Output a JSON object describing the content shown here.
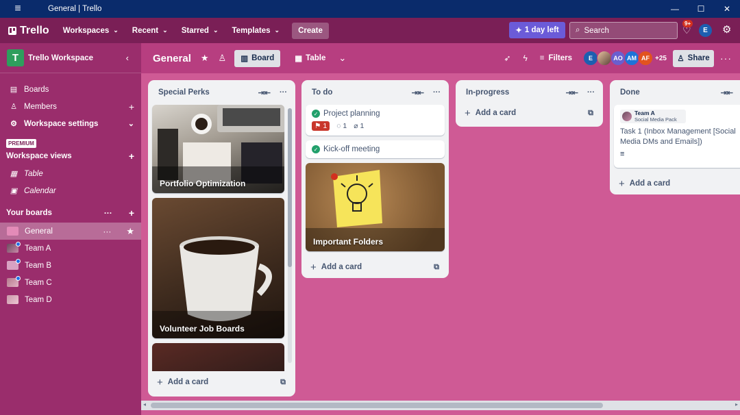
{
  "window": {
    "title": "General | Trello",
    "controls": [
      "—",
      "☐",
      "✕"
    ]
  },
  "topnav": {
    "logo": "Trello",
    "items": [
      "Workspaces",
      "Recent",
      "Starred",
      "Templates"
    ],
    "create": "Create",
    "trial": "1 day left",
    "search_placeholder": "Search",
    "notif_count": "9+",
    "avatar": "E"
  },
  "sidebar": {
    "workspace_initial": "T",
    "workspace_name": "Trello Workspace",
    "nav": [
      "Boards",
      "Members",
      "Workspace settings"
    ],
    "premium": "PREMIUM",
    "views_heading": "Workspace views",
    "views": [
      "Table",
      "Calendar"
    ],
    "boards_heading": "Your boards",
    "boards": [
      "General",
      "Team A",
      "Team B",
      "Team C",
      "Team D"
    ]
  },
  "board": {
    "title": "General",
    "views": [
      "Board",
      "Table"
    ],
    "filters": "Filters",
    "members": [
      "E",
      "",
      "AO",
      "AM",
      "AF"
    ],
    "more_members": "+25",
    "share": "Share"
  },
  "lists": [
    {
      "title": "Special Perks",
      "cards": [
        "Portfolio Optimization",
        "Volunteer Job Boards"
      ],
      "add": "Add a card"
    },
    {
      "title": "To do",
      "cards": [
        "Project planning",
        "Kick-off meeting",
        "Important Folders"
      ],
      "badges": {
        "votes": "1",
        "comments": "1",
        "attachments": "1"
      },
      "add": "Add a card"
    },
    {
      "title": "In-progress",
      "cards": [],
      "add": "Add a card"
    },
    {
      "title": "Done",
      "card": {
        "team": "Team A",
        "subtitle": "Social Media Pack",
        "text": "Task 1 (Inbox Management [Social Media DMs and Emails])"
      },
      "add": "Add a card"
    }
  ],
  "colors": {
    "nav": "#7a1f56",
    "sidebar": "#9a2d6c",
    "board_bg": "#cf5a95",
    "header": "#b73e80"
  }
}
